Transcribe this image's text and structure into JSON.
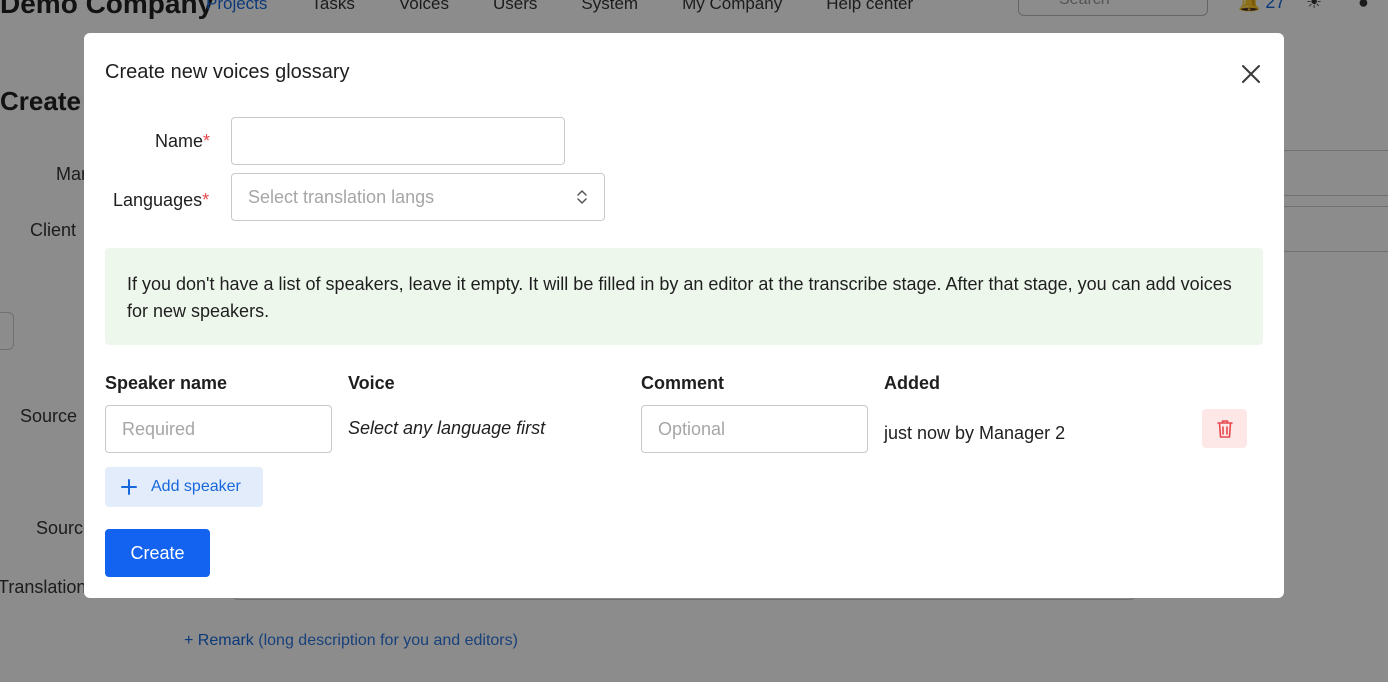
{
  "background": {
    "company": "Demo Company",
    "nav": [
      "Projects",
      "Tasks",
      "Voices",
      "Users",
      "System",
      "My Company",
      "Help center"
    ],
    "search_placeholder": "Search",
    "notifications_count": "27",
    "page_title": "Create Project",
    "labels": {
      "manager": "Manager",
      "client": "Client",
      "source": "Source",
      "source2": "Source",
      "translation": "Translation"
    },
    "remark_link": "Remark",
    "remark_hint": "(long description for you and editors)"
  },
  "modal": {
    "title": "Create new voices glossary",
    "name_label": "Name",
    "languages_label": "Languages",
    "required_mark": "*",
    "languages_placeholder": "Select translation langs",
    "notice": "If you don't have a list of speakers, leave it empty. It will be filled in by an editor at the transcribe stage. After that stage, you can add voices for new speakers.",
    "table": {
      "headers": {
        "speaker_name": "Speaker name",
        "voice": "Voice",
        "comment": "Comment",
        "added": "Added"
      },
      "rows": [
        {
          "speaker_placeholder": "Required",
          "voice_hint": "Select any language first",
          "comment_placeholder": "Optional",
          "added": "just now by Manager 2"
        }
      ]
    },
    "add_speaker_label": "Add speaker",
    "create_label": "Create"
  },
  "colors": {
    "primary": "#1363f0",
    "link": "#1668dc",
    "notice_bg": "#edf7ec",
    "danger": "#e5484d",
    "danger_bg": "#fde7e7"
  }
}
